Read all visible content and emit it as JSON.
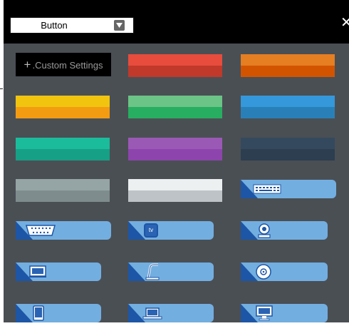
{
  "toolbar": {
    "dropdown_value": "Button",
    "close_glyph": "✕"
  },
  "custom_settings": {
    "plus": "+",
    "label": ".Custom Settings"
  },
  "swatches": [
    {
      "name": "red",
      "top": "#e74c3c",
      "bottom": "#c0392b"
    },
    {
      "name": "orange",
      "top": "#e67e22",
      "bottom": "#d35400"
    },
    {
      "name": "yellow",
      "top": "#f1c40f",
      "bottom": "#f39c12"
    },
    {
      "name": "green",
      "top": "#6cc486",
      "bottom": "#27ae60"
    },
    {
      "name": "blue",
      "top": "#3498db",
      "bottom": "#2980b9"
    },
    {
      "name": "teal",
      "top": "#1abc9c",
      "bottom": "#16a085"
    },
    {
      "name": "purple",
      "top": "#9b59b6",
      "bottom": "#8e44ad"
    },
    {
      "name": "navy",
      "top": "#34495e",
      "bottom": "#2c3e50"
    },
    {
      "name": "gray",
      "top": "#95a5a6",
      "bottom": "#7f8c8d"
    },
    {
      "name": "white",
      "top": "#ecf0f1",
      "bottom": "#bdc3c7"
    }
  ],
  "icon_tiles": [
    {
      "icon": "keyboard-icon"
    },
    {
      "icon": "vga-port-icon"
    },
    {
      "icon": "tv-icon",
      "text": "tv"
    },
    {
      "icon": "webcam-icon"
    },
    {
      "icon": "monitor-icon"
    },
    {
      "icon": "document-camera-icon"
    },
    {
      "icon": "disc-icon"
    },
    {
      "icon": "tablet-icon"
    },
    {
      "icon": "laptop-icon"
    },
    {
      "icon": "desktop-icon"
    }
  ],
  "colors": {
    "background": "#4a4f54",
    "tile_light": "#73aee0",
    "tile_dark": "#1d56a6"
  }
}
